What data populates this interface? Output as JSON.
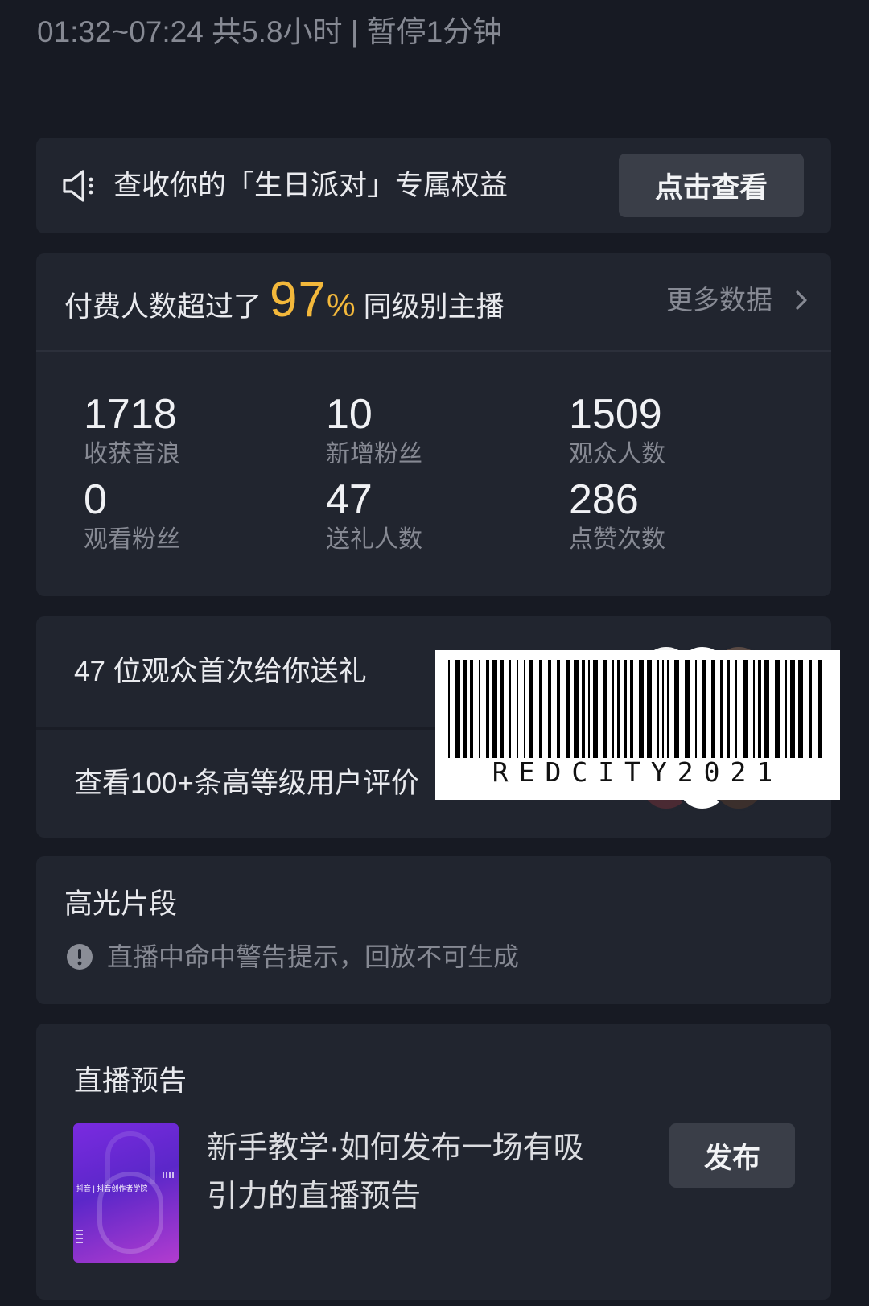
{
  "header": {
    "session_summary": "01:32~07:24 共5.8小时 | 暂停1分钟"
  },
  "banner": {
    "icon": "speaker-icon",
    "text": "查收你的「生日派对」专属权益",
    "button_label": "点击查看"
  },
  "ranking": {
    "prefix": "付费人数超过了",
    "percent_value": "97",
    "percent_sign": "%",
    "suffix": "同级别主播",
    "more_label": "更多数据",
    "more_icon": "chevron-right-icon"
  },
  "stats": [
    {
      "value": "1718",
      "label": "收获音浪"
    },
    {
      "value": "10",
      "label": "新增粉丝"
    },
    {
      "value": "1509",
      "label": "观众人数"
    },
    {
      "value": "0",
      "label": "观看粉丝"
    },
    {
      "value": "47",
      "label": "送礼人数"
    },
    {
      "value": "286",
      "label": "点赞次数"
    }
  ],
  "gifts": {
    "first_gift_text": "47 位观众首次给你送礼",
    "reviews_text": "查看100+条高等级用户评价"
  },
  "barcode": {
    "text": "REDCITY2021"
  },
  "highlights": {
    "title": "高光片段",
    "warning_icon": "exclamation-circle-icon",
    "warning_text": "直播中命中警告提示，回放不可生成"
  },
  "preview": {
    "title": "直播预告",
    "thumbnail_text": "抖音 | 抖音创作者学院",
    "description_line1": "新手教学·如何发布一场有吸",
    "description_line2": "引力的直播预告",
    "publish_label": "发布"
  },
  "colors": {
    "background": "#171a23",
    "card": "#21252f",
    "button": "#3a3e48",
    "accent_yellow": "#f3b83b",
    "muted_text": "#868993"
  }
}
